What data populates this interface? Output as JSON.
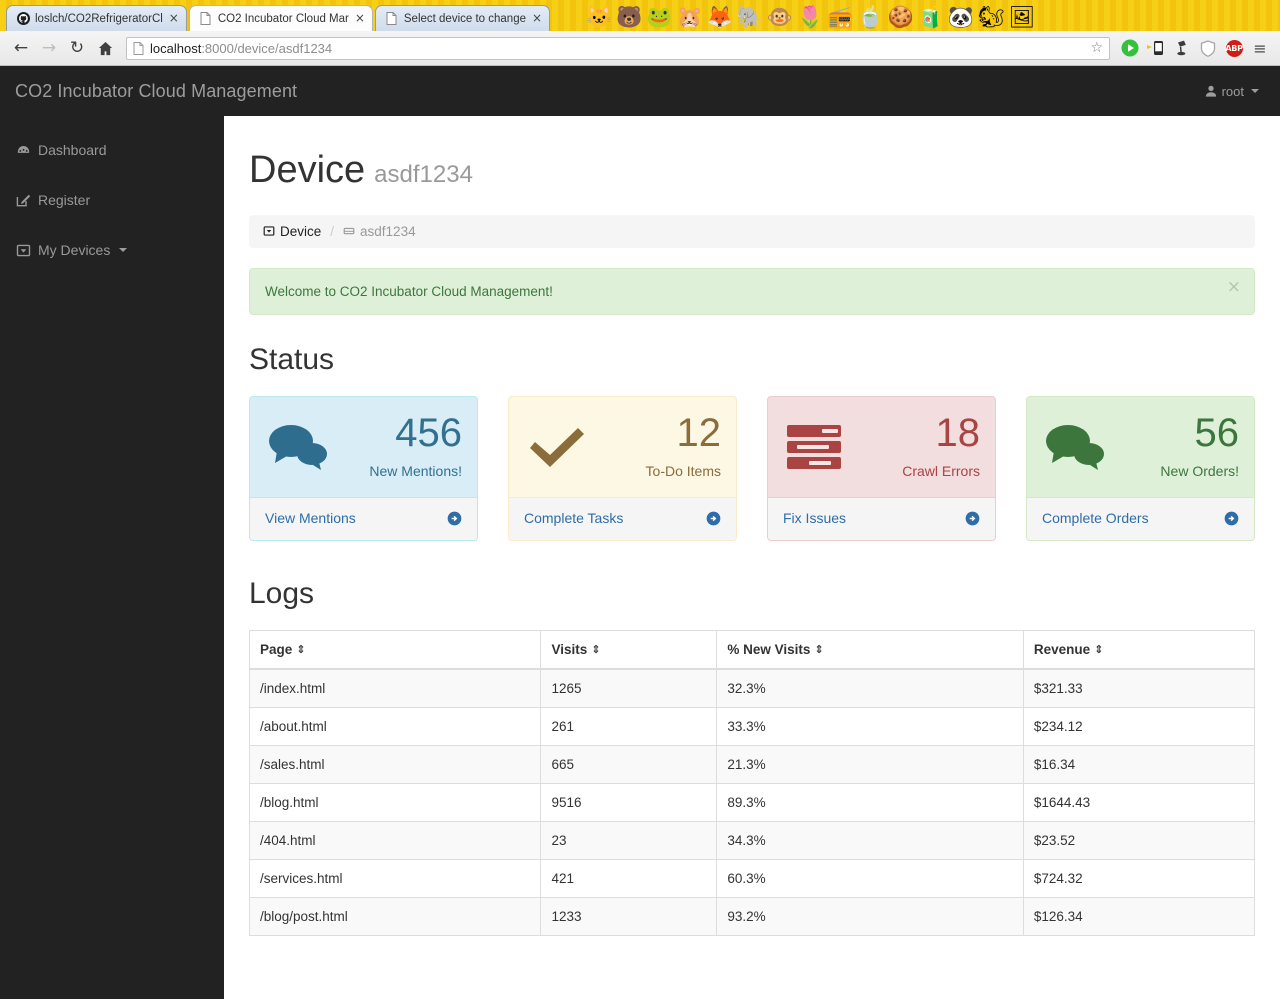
{
  "browser": {
    "tabs": [
      {
        "title": "loslch/CO2RefrigeratorCl",
        "favicon": "github-icon",
        "active": false,
        "close": "×"
      },
      {
        "title": "CO2 Incubator Cloud Mar",
        "favicon": "page-icon",
        "active": true,
        "close": "×"
      },
      {
        "title": "Select device to change",
        "favicon": "page-icon",
        "active": false,
        "close": "×"
      }
    ],
    "theme_critters": "🐱🐻🐸🐹🦊🐘🐵🌷📻🍵🍪🧃🐼🐿🖼",
    "nav": {
      "back": "←",
      "forward": "→",
      "reload": "↻",
      "home": "⌂"
    },
    "url": {
      "page_icon": "὜b",
      "host": "localhost",
      "rest": ":8000/device/asdf1234",
      "star": "☆"
    },
    "extensions": [
      {
        "name": "play-button-icon",
        "glyph": "▶"
      },
      {
        "name": "mobile-phone-icon",
        "glyph": ""
      },
      {
        "name": "lamp-icon",
        "glyph": ""
      },
      {
        "name": "shield-icon",
        "glyph": "⛉"
      },
      {
        "name": "adblock-plus-icon",
        "glyph": "ABP"
      },
      {
        "name": "browser-menu-icon",
        "glyph": "≡"
      }
    ]
  },
  "navbar": {
    "brand": "CO2 Incubator Cloud Management",
    "user": "root"
  },
  "sidebar": {
    "items": [
      {
        "label": "Dashboard",
        "icon": "dashboard-icon"
      },
      {
        "label": "Register",
        "icon": "pencil-square-icon"
      },
      {
        "label": "My Devices",
        "icon": "hdd-icon",
        "has_caret": true
      }
    ]
  },
  "page": {
    "title": "Device",
    "subtitle": "asdf1234",
    "breadcrumb": [
      {
        "label": "Device",
        "icon": "hdd-icon",
        "active": false
      },
      {
        "label": "asdf1234",
        "icon": "inbox-icon",
        "active": true
      }
    ],
    "breadcrumb_separator": "/",
    "alert": {
      "message": "Welcome to CO2 Incubator Cloud Management!",
      "close": "×"
    },
    "status_heading": "Status",
    "logs_heading": "Logs"
  },
  "panels": [
    {
      "variant": "primary",
      "icon": "comments-icon",
      "value": "456",
      "label": "New Mentions!",
      "footer_label": "View Mentions",
      "footer_icon": "circle-arrow-right-icon",
      "color": "#31708f",
      "bg": "#d9edf7"
    },
    {
      "variant": "warning",
      "icon": "check-icon",
      "value": "12",
      "label": "To-Do Items",
      "footer_label": "Complete Tasks",
      "footer_icon": "circle-arrow-right-icon",
      "color": "#8a6d3b",
      "bg": "#fcf8e3"
    },
    {
      "variant": "danger",
      "icon": "tasks-icon",
      "value": "18",
      "label": "Crawl Errors",
      "footer_label": "Fix Issues",
      "footer_icon": "circle-arrow-right-icon",
      "color": "#a94442",
      "bg": "#f2dede"
    },
    {
      "variant": "success",
      "icon": "comments-icon",
      "value": "56",
      "label": "New Orders!",
      "footer_label": "Complete Orders",
      "footer_icon": "circle-arrow-right-icon",
      "color": "#3c763d",
      "bg": "#dff0d8"
    }
  ],
  "logs_table": {
    "columns": [
      {
        "label": "Page",
        "sort_icon": "sort-icon"
      },
      {
        "label": "Visits",
        "sort_icon": "sort-icon"
      },
      {
        "label": "% New Visits",
        "sort_icon": "sort-icon"
      },
      {
        "label": "Revenue",
        "sort_icon": "sort-icon"
      }
    ],
    "rows": [
      {
        "page": "/index.html",
        "visits": "1265",
        "new_visits": "32.3%",
        "revenue": "$321.33"
      },
      {
        "page": "/about.html",
        "visits": "261",
        "new_visits": "33.3%",
        "revenue": "$234.12"
      },
      {
        "page": "/sales.html",
        "visits": "665",
        "new_visits": "21.3%",
        "revenue": "$16.34"
      },
      {
        "page": "/blog.html",
        "visits": "9516",
        "new_visits": "89.3%",
        "revenue": "$1644.43"
      },
      {
        "page": "/404.html",
        "visits": "23",
        "new_visits": "34.3%",
        "revenue": "$23.52"
      },
      {
        "page": "/services.html",
        "visits": "421",
        "new_visits": "60.3%",
        "revenue": "$724.32"
      },
      {
        "page": "/blog/post.html",
        "visits": "1233",
        "new_visits": "93.2%",
        "revenue": "$126.34"
      }
    ]
  }
}
